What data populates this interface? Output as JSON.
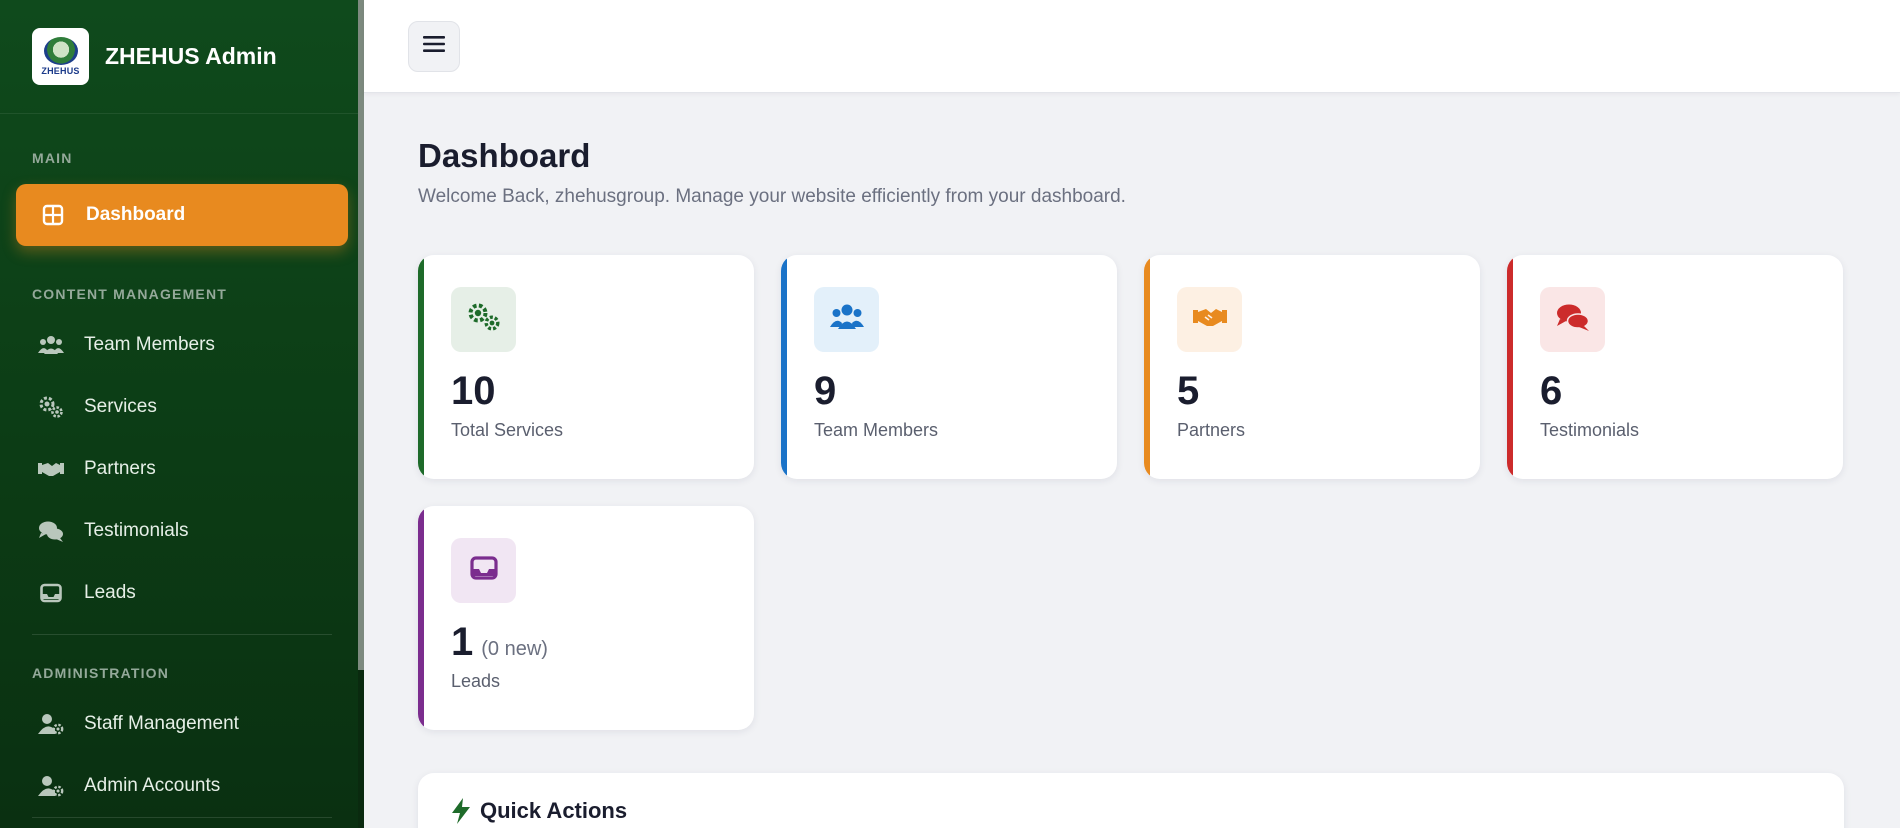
{
  "brand": {
    "title": "ZHEHUS Admin",
    "logo_text": "ZHEHUS"
  },
  "sidebar": {
    "sections": {
      "main": "MAIN",
      "content": "CONTENT MANAGEMENT",
      "admin": "ADMINISTRATION"
    },
    "items": [
      {
        "label": "Dashboard",
        "icon": "dashboard-grid-icon",
        "active": true
      },
      {
        "label": "Team Members",
        "icon": "users-icon",
        "active": false
      },
      {
        "label": "Services",
        "icon": "cogs-icon",
        "active": false
      },
      {
        "label": "Partners",
        "icon": "handshake-icon",
        "active": false
      },
      {
        "label": "Testimonials",
        "icon": "comments-icon",
        "active": false
      },
      {
        "label": "Leads",
        "icon": "inbox-icon",
        "active": false
      },
      {
        "label": "Staff Management",
        "icon": "user-cog-icon",
        "active": false
      },
      {
        "label": "Admin Accounts",
        "icon": "user-cog-icon",
        "active": false
      }
    ]
  },
  "topbar": {
    "menu_icon": "hamburger-icon"
  },
  "main": {
    "title": "Dashboard",
    "subtitle": "Welcome Back, zhehusgroup. Manage your website efficiently from your dashboard."
  },
  "stats": [
    {
      "value": "10",
      "label": "Total Services",
      "extra": "",
      "accent": "#1e6b2a",
      "icon": "cogs-icon",
      "icon_bg": "#e6efe7"
    },
    {
      "value": "9",
      "label": "Team Members",
      "extra": "",
      "accent": "#1a73c8",
      "icon": "users-icon",
      "icon_bg": "#e3f0fa"
    },
    {
      "value": "5",
      "label": "Partners",
      "extra": "",
      "accent": "#e88a1f",
      "icon": "handshake-icon",
      "icon_bg": "#fdf0e3"
    },
    {
      "value": "6",
      "label": "Testimonials",
      "extra": "",
      "accent": "#cc2b2b",
      "icon": "comments-icon",
      "icon_bg": "#fae6e6"
    },
    {
      "value": "1",
      "label": "Leads",
      "extra": "(0 new)",
      "accent": "#7b2d8e",
      "icon": "inbox-icon",
      "icon_bg": "#f1e6f3"
    }
  ],
  "quick_actions": {
    "title": "Quick Actions",
    "icon": "bolt-icon"
  },
  "colors": {
    "sidebar_bg": "#0f4a1c",
    "active_item": "#e88a1f",
    "page_bg": "#f1f2f5"
  }
}
